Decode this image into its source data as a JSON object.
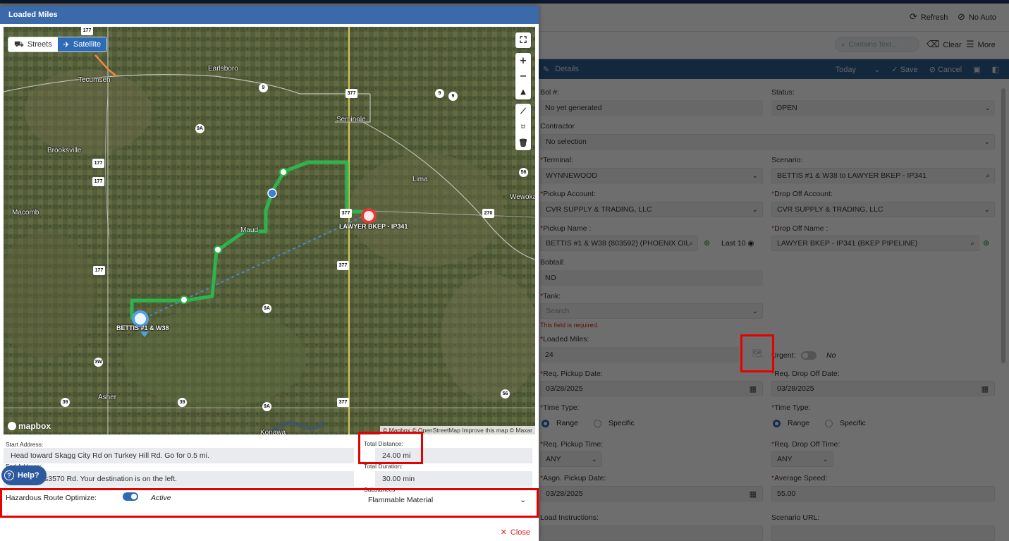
{
  "background": {
    "toolbar": {
      "refresh": "Refresh",
      "no_auto": "No Auto",
      "search_placeholder": "Contains Text...",
      "clear": "Clear",
      "more": "More"
    },
    "details_bar": {
      "title": "Details",
      "date_filter": "Today",
      "save": "Save",
      "cancel": "Cancel"
    },
    "form": {
      "bol_label": "Bol #:",
      "bol_value": "No yet generated",
      "status_label": "Status:",
      "status_value": "OPEN",
      "contractor_label": "Contractor",
      "contractor_value": "No selection",
      "terminal_label": "Terminal:",
      "terminal_value": "WYNNEWOOD",
      "scenario_label": "Scenario:",
      "scenario_value": "BETTIS #1 & W38 to LAWYER BKEP - IP341",
      "pickup_account_label": "Pickup Account:",
      "pickup_account_value": "CVR SUPPLY & TRADING, LLC",
      "dropoff_account_label": "Drop Off Account:",
      "dropoff_account_value": "CVR SUPPLY & TRADING, LLC",
      "pickup_name_label": "Pickup Name :",
      "pickup_name_value": "BETTIS #1 & W38 (803592) (PHOENIX OIL",
      "last10": "Last 10",
      "dropoff_name_label": "Drop Off Name :",
      "dropoff_name_value": "LAWYER BKEP - IP341  (BKEP PIPELINE)",
      "bobtail_label": "Bobtail:",
      "bobtail_value": "NO",
      "tank_label": "Tank:",
      "tank_placeholder": "Search",
      "tank_error": "This field is required.",
      "loaded_miles_label": "Loaded Miles:",
      "loaded_miles_value": "24",
      "urgent_label": "Urgent:",
      "urgent_value": "No",
      "req_pickup_date_label": "Req. Pickup Date:",
      "req_pickup_date_value": "03/28/2025",
      "req_dropoff_date_label": "Req. Drop Off Date:",
      "req_dropoff_date_value": "03/28/2025",
      "time_type_label": "Time Type:",
      "time_type_label2": "Time Type:",
      "range": "Range",
      "specific": "Specific",
      "req_pickup_time_label": "Req. Pickup Time:",
      "req_pickup_time_value": "ANY",
      "req_dropoff_time_label": "Req. Drop Off Time:",
      "req_dropoff_time_value": "ANY",
      "asgn_pickup_date_label": "Asgn. Pickup Date:",
      "asgn_pickup_date_value": "03/28/2025",
      "avg_speed_label": "Average Speed:",
      "avg_speed_value": "55.00",
      "load_instructions_label": "Load Instructions:",
      "scenario_url_label": "Scenario URL:"
    }
  },
  "modal": {
    "title": "Loaded Miles",
    "map": {
      "streets_label": "Streets",
      "satellite_label": "Satellite",
      "mapbox_text": "mapbox",
      "attribution": "© Mapbox © OpenStreetMap  Improve this map © Maxar",
      "places": [
        "Earlsboro",
        "Tecumseh",
        "Seminole",
        "Brooksville",
        "Lima",
        "Macomb",
        "Wewoka",
        "Asher",
        "Konawa",
        "Maud"
      ],
      "shields": [
        "177",
        "9",
        "377",
        "9",
        "9",
        "9A",
        "177",
        "177",
        "56",
        "377",
        "270",
        "377",
        "177",
        "9A",
        "3W",
        "39",
        "39",
        "9A",
        "377",
        "56"
      ],
      "origin_label": "BETTIS #1 & W38",
      "destination_label": "LAWYER BKEP - IP341"
    },
    "start_address_label": "Start Address:",
    "start_address_value": "Head toward Skagg City Rd on Turkey Hill Rd. Go for 0.5 mi.",
    "end_address_label": "End Address:",
    "end_address_value": "s3570 Rd. Your destination is on the left.",
    "total_distance_label": "Total Distance:",
    "total_distance_value": "24.00 mi",
    "total_duration_label": "Total Duration:",
    "total_duration_value": "30.00 min",
    "hazard_label": "Hazardous Route Optimize:",
    "hazard_state": "Active",
    "substances_label": "Substances",
    "substances_value": "Flammable Material",
    "help_label": "Help?",
    "close_label": "Close"
  }
}
